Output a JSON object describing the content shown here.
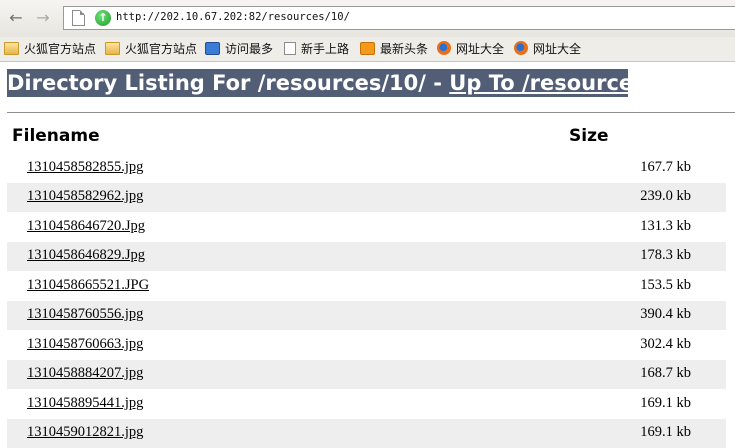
{
  "browser": {
    "url": "http://202.10.67.202:82/resources/10/",
    "bookmarks": [
      {
        "label": "火狐官方站点",
        "icon": "folder-icon"
      },
      {
        "label": "火狐官方站点",
        "icon": "folder-icon"
      },
      {
        "label": "访问最多",
        "icon": "search-icon"
      },
      {
        "label": "新手上路",
        "icon": "page-icon"
      },
      {
        "label": "最新头条",
        "icon": "rss-icon"
      },
      {
        "label": "网址大全",
        "icon": "firefox-icon"
      },
      {
        "label": "网址大全",
        "icon": "firefox-icon"
      }
    ]
  },
  "page": {
    "heading_prefix": "Directory Listing For /resources/10/ - ",
    "heading_link": "Up To /resources",
    "col_filename": "Filename",
    "col_size": "Size",
    "files": [
      {
        "name": "1310458582855.jpg",
        "size": "167.7 kb"
      },
      {
        "name": "1310458582962.jpg",
        "size": "239.0 kb"
      },
      {
        "name": "1310458646720.Jpg",
        "size": "131.3 kb"
      },
      {
        "name": "1310458646829.Jpg",
        "size": "178.3 kb"
      },
      {
        "name": "1310458665521.JPG",
        "size": "153.5 kb"
      },
      {
        "name": "1310458760556.jpg",
        "size": "390.4 kb"
      },
      {
        "name": "1310458760663.jpg",
        "size": "302.4 kb"
      },
      {
        "name": "1310458884207.jpg",
        "size": "168.7 kb"
      },
      {
        "name": "1310458895441.jpg",
        "size": "169.1 kb"
      },
      {
        "name": "1310459012821.jpg",
        "size": "169.1 kb"
      }
    ]
  },
  "colors": {
    "heading_bg": "#525d76",
    "alt_row_bg": "#eeeeee"
  }
}
